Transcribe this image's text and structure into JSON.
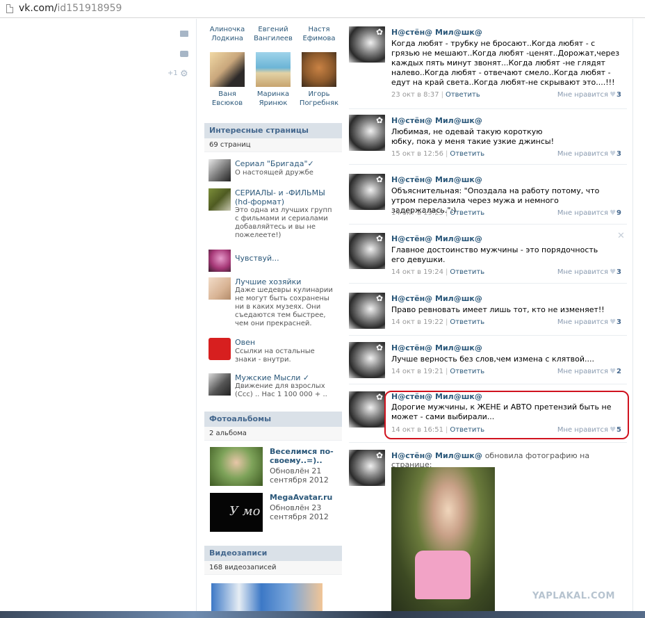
{
  "browser": {
    "url_host": "vk.com/",
    "url_path": "id151918959"
  },
  "left_icons": {
    "plus_count": "+1"
  },
  "friends": [
    {
      "first": "Алиночка",
      "last": "Лодкина"
    },
    {
      "first": "Евгений",
      "last": "Вангилеев"
    },
    {
      "first": "Настя",
      "last": "Ефимова"
    },
    {
      "first": "Ваня",
      "last": "Евсюков"
    },
    {
      "first": "Маринка",
      "last": "Яринюк"
    },
    {
      "first": "Игорь",
      "last": "Погребняк"
    }
  ],
  "pages": {
    "title": "Интересные страницы",
    "count": "69 страниц",
    "items": [
      {
        "title": "Сериал \"Бригада\"",
        "verified": "✓",
        "desc": "О настоящей дружбе"
      },
      {
        "title": "СЕРИАЛЫ- и -ФИЛЬМЫ (hd-формат)",
        "desc": "Это одна из лучших групп с фильмами и сериалами добавляйтесь и вы не пожелеете!)"
      },
      {
        "title": "Чувствуй...",
        "desc": ""
      },
      {
        "title": "Лучшие хозяйки",
        "desc": "Даже шедевры кулинарии не могут быть сохранены ни в каких музеях. Они съедаются тем быстрее, чем они прекрасней."
      },
      {
        "title": "Овен",
        "desc": "Ссылки на остальные знаки - внутри."
      },
      {
        "title": "Мужские Мысли",
        "verified": "✓",
        "desc": "Движение для взрослых (Ссс) .. Нас 1 100 000 + .."
      }
    ]
  },
  "albums": {
    "title": "Фотоальбомы",
    "count": "2 альбома",
    "items": [
      {
        "title": "Веселимся по-своему..=)..",
        "updated": "Обновлён 21 сентября 2012"
      },
      {
        "title": "MegaAvatar.ru",
        "updated": "Обновлён 23 сентября 2012",
        "thumb_text": "У мо"
      }
    ]
  },
  "videos": {
    "title": "Видеозаписи",
    "count": "168 видеозаписей"
  },
  "feed": {
    "author": "Н@стён@ Мил@шк@",
    "reply": "Ответить",
    "like_label": "Мне нравится",
    "posts": [
      {
        "text": "Когда любят - трубку не бросают..Когда любят - с грязью не мешают..Когда любят -ценят..Дорожат,через каждых пять минут звонят...Когда любят -не глядят налево..Когда любят - отвечают смело..Когда любят - едут на край света..Когда любят-не скрывают это....!!!",
        "date": "23 окт в 8:37",
        "likes": "3"
      },
      {
        "text": "Любимая, не одевай такую короткую юбку, пока у меня такие узкие джинсы!",
        "date": "15 окт в 12:56",
        "likes": "3"
      },
      {
        "text": "Объяснительная: \"Опоздала на работу потому, что утром перелазила через мужа и немного задержалась.\":)",
        "date": "14 окт в 19:25",
        "likes": "9"
      },
      {
        "text": "Главное достоинство мужчины - это порядочность его девушки.",
        "date": "14 окт в 19:24",
        "likes": "3"
      },
      {
        "text": "Право ревновать имеет лишь тот, кто не изменяет!!",
        "date": "14 окт в 19:22",
        "likes": "3"
      },
      {
        "text": "Лучше верность без слов,чем измена с клятвой....",
        "date": "14 окт в 19:21",
        "likes": "2"
      },
      {
        "text": "Дорогие мужчины, к ЖЕНЕ и АВТО претензий быть не может - сами выбирали...",
        "date": "14 окт в 16:51",
        "likes": "5"
      }
    ],
    "photo_update": "обновила фотографию на странице:"
  },
  "watermark": "YAPLAKAL.COM",
  "colors": {
    "link": "#2b587a",
    "header_bg": "#dae1e8",
    "highlight": "#d0121e"
  }
}
